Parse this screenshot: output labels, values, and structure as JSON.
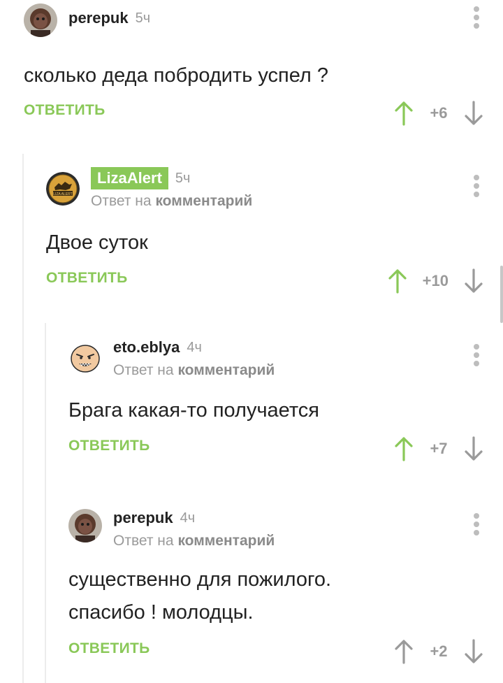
{
  "reply_to_prefix": "Ответ на",
  "reply_to_target": "комментарий",
  "reply_label": "ОТВЕТИТЬ",
  "comments": [
    {
      "author": "perepuk",
      "time": "5ч",
      "text": "сколько деда побродить успел ?",
      "rating": "+6",
      "upvoted": true
    },
    {
      "author": "LizaAlert",
      "time": "5ч",
      "is_reply": true,
      "text": "Двое суток",
      "rating": "+10",
      "upvoted": true
    },
    {
      "author": "eto.eblya",
      "time": "4ч",
      "is_reply": true,
      "text": "Брага какая-то получается",
      "rating": "+7",
      "upvoted": true
    },
    {
      "author": "perepuk",
      "time": "4ч",
      "is_reply": true,
      "text_lines": [
        "существенно для пожилого.",
        "спасибо ! молодцы."
      ],
      "rating": "+2",
      "upvoted": false
    }
  ],
  "colors": {
    "accent_green": "#8ac858",
    "muted_gray": "#9a9a9a",
    "text": "#222222"
  },
  "avatar_logo_text": "LIZA ALERT"
}
